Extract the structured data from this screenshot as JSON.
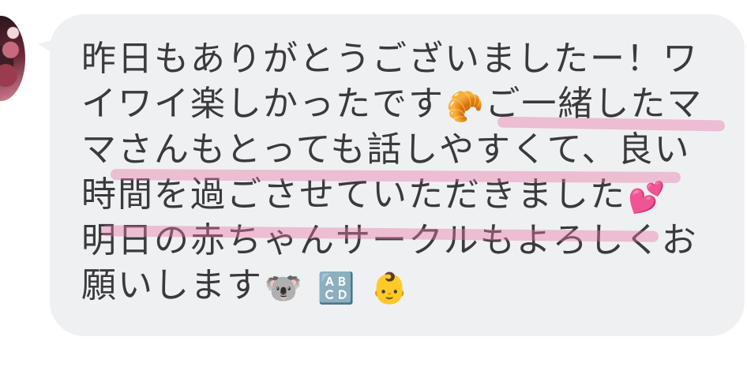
{
  "message": {
    "lines": [
      "昨日もありがとうございましたー！ワ",
      "イワイ楽しかったです",
      "ご一緒したマ",
      "マさんもとっても話しやすくて、良い",
      "時間を過ごさせていただきました",
      "明日の赤ちゃんサークルもよろしくお",
      "願いします"
    ],
    "emojis": {
      "croissant": "🥐",
      "two_hearts": "💕",
      "koala": "🐨",
      "abcd": "🔠",
      "baby": "👶"
    }
  },
  "colors": {
    "bubble": "#eff0f2",
    "text": "#3a3a3c",
    "highlight": "#e678aa"
  }
}
